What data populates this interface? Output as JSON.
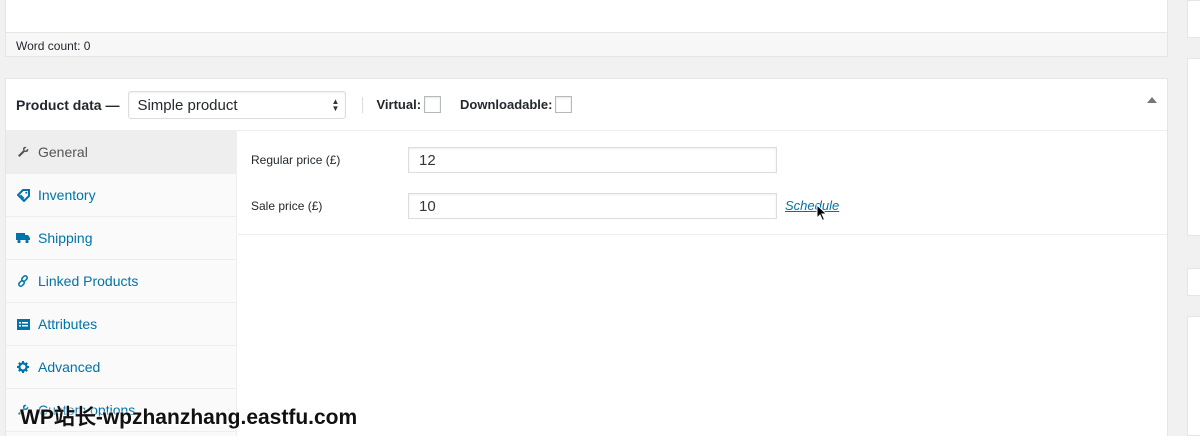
{
  "editor": {
    "word_count": "Word count: 0"
  },
  "product_data": {
    "title": "Product data —",
    "product_type": {
      "selected": "Simple product"
    },
    "options": {
      "virtual_label": "Virtual:",
      "downloadable_label": "Downloadable:"
    },
    "tabs": [
      {
        "label": "General",
        "icon": "wrench-icon",
        "active": true
      },
      {
        "label": "Inventory",
        "icon": "tag-icon"
      },
      {
        "label": "Shipping",
        "icon": "truck-icon"
      },
      {
        "label": "Linked Products",
        "icon": "link-icon"
      },
      {
        "label": "Attributes",
        "icon": "list-icon"
      },
      {
        "label": "Advanced",
        "icon": "gear-icon"
      },
      {
        "label": "Custom options",
        "icon": "wrench-icon"
      }
    ],
    "fields": {
      "regular_price": {
        "label": "Regular price (£)",
        "value": "12"
      },
      "sale_price": {
        "label": "Sale price (£)",
        "value": "10",
        "link": "Schedule"
      }
    }
  },
  "watermark": "WP站长-wpzhanzhang.eastfu.com",
  "colors": {
    "link": "#0073aa",
    "active_tab_bg": "#eeeeee"
  }
}
